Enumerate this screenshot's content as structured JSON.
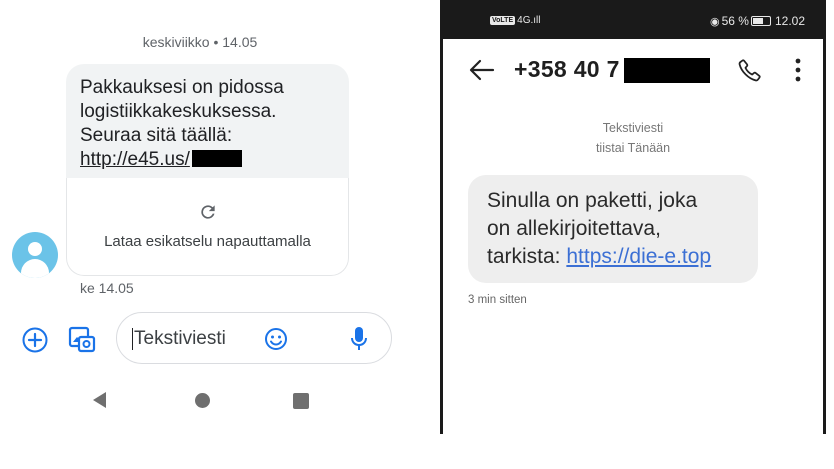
{
  "left_phone": {
    "date_header": "keskiviikko • 14.05",
    "message": {
      "line1": "Pakkauksesi on pidossa",
      "line2": "logistiikkakeskuksessa.",
      "line3": "Seuraa sitä täällä:",
      "link": "http://e45.us/"
    },
    "preview_text": "Lataa esikatselu napauttamalla",
    "timestamp": "ke 14.05",
    "compose_placeholder": "Tekstiviesti",
    "icons": [
      "reload-icon",
      "avatar-icon",
      "add-icon",
      "gallery-icon",
      "emoji-icon",
      "mic-icon",
      "nav-back-icon",
      "nav-home-icon",
      "nav-recents-icon"
    ],
    "avatar_color": "#6bc3e8",
    "accent_color": "#1a73e8"
  },
  "right_phone": {
    "status_bar": {
      "volte": "VoLTE",
      "signal": "4G.ıll",
      "battery_percent": "56 %",
      "time": "12.02"
    },
    "contact_number": "+358 40 7",
    "sms_label": "Tekstiviesti",
    "day_label": "tiistai Tänään",
    "message": {
      "line1": "Sinulla on paketti, joka",
      "line2": "on allekirjoitettava,",
      "line3_prefix": "tarkista: ",
      "link": "https://die-e.top"
    },
    "timestamp": "3 min sitten",
    "icons": [
      "back-arrow-icon",
      "phone-icon",
      "more-vert-icon",
      "eye-icon",
      "battery-icon"
    ],
    "link_color": "#3b6fd4"
  }
}
